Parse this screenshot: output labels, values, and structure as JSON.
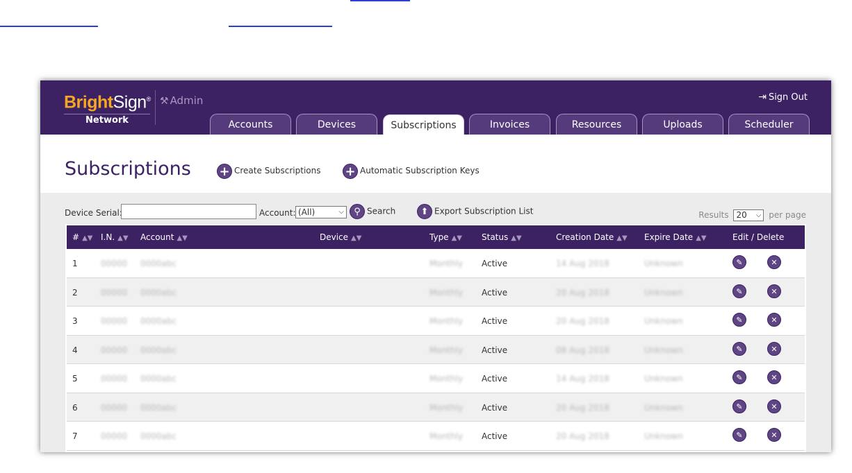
{
  "header": {
    "logo_brand": "BrightSign",
    "logo_network": "Network",
    "admin_label": "Admin",
    "sign_out": "Sign Out",
    "tabs": [
      {
        "label": "Accounts",
        "active": false
      },
      {
        "label": "Devices",
        "active": false
      },
      {
        "label": "Subscriptions",
        "active": true
      },
      {
        "label": "Invoices",
        "active": false
      },
      {
        "label": "Resources",
        "active": false
      },
      {
        "label": "Uploads",
        "active": false
      },
      {
        "label": "Scheduler",
        "active": false
      }
    ]
  },
  "page": {
    "title": "Subscriptions",
    "create_button": "Create Subscriptions",
    "auto_keys_button": "Automatic Subscription Keys"
  },
  "filters": {
    "device_serial_label": "Device Serial:",
    "device_serial_value": "",
    "account_label": "Account:",
    "account_selected": "(All)",
    "search_label": "Search",
    "export_label": "Export Subscription List",
    "results_label": "Results",
    "results_per_page": "20",
    "per_page_label": "per page"
  },
  "table": {
    "columns": [
      "#",
      "I.N.",
      "Account",
      "Device",
      "Type",
      "Status",
      "Creation Date",
      "Expire Date",
      "Edit / Delete"
    ],
    "rows": [
      {
        "num": "1",
        "in": "00000",
        "account": "0000abc",
        "device": "",
        "type": "Monthly",
        "status": "Active",
        "created": "14 Aug 2018",
        "expires": "Unknown"
      },
      {
        "num": "2",
        "in": "00000",
        "account": "0000abc",
        "device": "",
        "type": "Monthly",
        "status": "Active",
        "created": "20 Aug 2018",
        "expires": "Unknown"
      },
      {
        "num": "3",
        "in": "00000",
        "account": "0000abc",
        "device": "",
        "type": "Monthly",
        "status": "Active",
        "created": "20 Aug 2018",
        "expires": "Unknown"
      },
      {
        "num": "4",
        "in": "00000",
        "account": "0000abc",
        "device": "",
        "type": "Monthly",
        "status": "Active",
        "created": "08 Aug 2018",
        "expires": "Unknown"
      },
      {
        "num": "5",
        "in": "00000",
        "account": "0000abc",
        "device": "",
        "type": "Monthly",
        "status": "Active",
        "created": "14 Aug 2018",
        "expires": "Unknown"
      },
      {
        "num": "6",
        "in": "00000",
        "account": "0000abc",
        "device": "",
        "type": "Monthly",
        "status": "Active",
        "created": "20 Aug 2018",
        "expires": "Unknown"
      },
      {
        "num": "7",
        "in": "00000",
        "account": "0000abc",
        "device": "",
        "type": "Monthly",
        "status": "Active",
        "created": "20 Aug 2018",
        "expires": "Unknown"
      }
    ]
  },
  "colors": {
    "brand_purple": "#3c2163",
    "brand_orange": "#f5a623",
    "link_blue": "#2b3fd8"
  }
}
